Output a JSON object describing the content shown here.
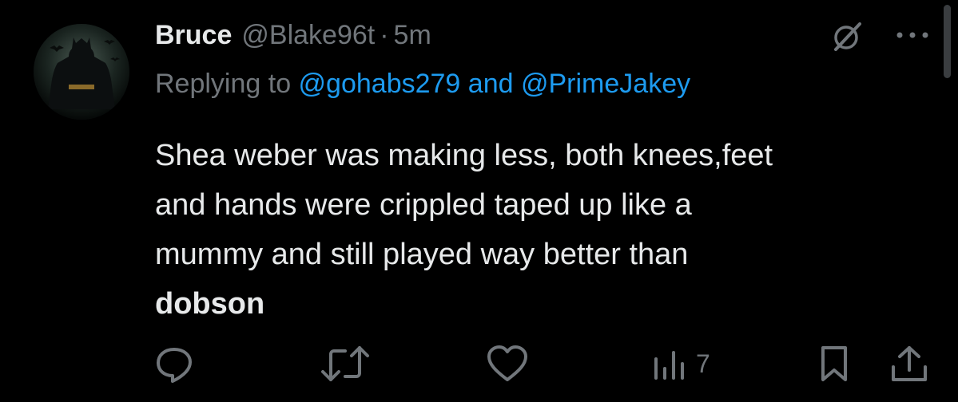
{
  "tweet": {
    "author": {
      "name": "Bruce",
      "handle": "@Blake96t",
      "separator": "·",
      "time": "5m"
    },
    "replying": {
      "prefix": "Replying to",
      "mentions": [
        "@gohabs279",
        "@PrimeJakey"
      ],
      "conjunction": "and"
    },
    "text_lines": [
      "Shea weber was making less, both knees,feet",
      "and hands were crippled taped up like a",
      "mummy and still played way better than"
    ],
    "bold_line": "dobson",
    "actions": {
      "reply": {
        "icon": "reply-icon"
      },
      "retweet": {
        "icon": "retweet-icon"
      },
      "like": {
        "icon": "heart-icon"
      },
      "views": {
        "icon": "views-icon",
        "count": "7"
      },
      "bookmark": {
        "icon": "bookmark-icon"
      },
      "share": {
        "icon": "share-icon"
      }
    },
    "header_icons": [
      "grok-icon",
      "more-icon"
    ]
  },
  "colors": {
    "background": "#000000",
    "text": "#e7e9ea",
    "muted": "#71767b",
    "link": "#1d9bf0"
  }
}
